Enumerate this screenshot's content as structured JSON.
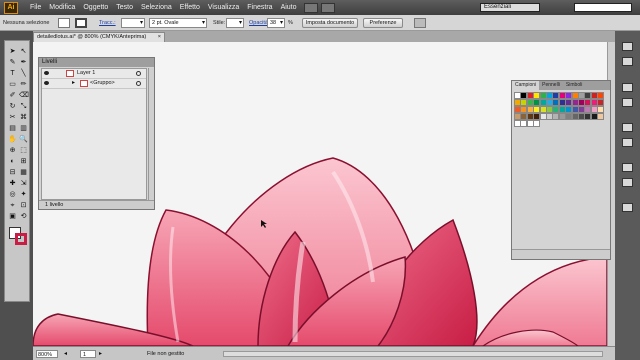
{
  "app": {
    "logo_text": "Ai"
  },
  "menu": [
    "File",
    "Modifica",
    "Oggetto",
    "Testo",
    "Seleziona",
    "Effetto",
    "Visualizza",
    "Finestra",
    "Aiuto"
  ],
  "workspace": {
    "label": "Essenziali"
  },
  "control_bar": {
    "selection_label": "Nessuna selezione",
    "stroke_label": "Tracc.:",
    "brush_value": "2 pt. Ovale",
    "style_label": "Stile:",
    "opacity_label": "Opacità:",
    "opacity_value": "38",
    "opacity_unit": "%",
    "doc_setup_button": "Imposta documento",
    "prefs_button": "Preferenze"
  },
  "document": {
    "tab_title": "detailedlotus.ai* @ 800% (CMYK/Anteprima)",
    "close_glyph": "×"
  },
  "layers_panel": {
    "title": "Livelli",
    "rows": [
      {
        "name": "Layer 1"
      },
      {
        "name": "<Gruppo>"
      }
    ],
    "footer_count": "1 livello"
  },
  "swatches_panel": {
    "tabs": [
      "Campioni",
      "Pennelli",
      "Simboli"
    ],
    "colors": [
      "#ffffff",
      "#000000",
      "#e02020",
      "#ffe600",
      "#2bb34a",
      "#00a8e0",
      "#1d3fa8",
      "#e6007e",
      "#8a2be2",
      "#ff7f00",
      "#a0a0a0",
      "#404040",
      "#d02020",
      "#ff4500",
      "#f2a900",
      "#c8d400",
      "#39b54a",
      "#009245",
      "#00a99d",
      "#29abe2",
      "#0071bc",
      "#2e3192",
      "#662d91",
      "#93278f",
      "#9e005d",
      "#d4145a",
      "#ed1e79",
      "#c1272d",
      "#f15a24",
      "#f7931e",
      "#fbb03b",
      "#fcee21",
      "#d9e021",
      "#8cc63f",
      "#22b573",
      "#00a99d",
      "#0093d0",
      "#3f59a8",
      "#7f3f98",
      "#bd7ab3",
      "#f29fc5",
      "#ffdead",
      "#c69c6d",
      "#8c6239",
      "#603813",
      "#42210b",
      "#e6e6e6",
      "#cccccc",
      "#b3b3b3",
      "#999999",
      "#808080",
      "#666666",
      "#4d4d4d",
      "#333333",
      "#1a1a1a",
      "#f0c8a0",
      "#ffffff",
      "#ffffff",
      "#ffffff",
      "#ffffff"
    ]
  },
  "status_bar": {
    "zoom": "800%",
    "page": "1",
    "status_text": "File non gestito"
  }
}
